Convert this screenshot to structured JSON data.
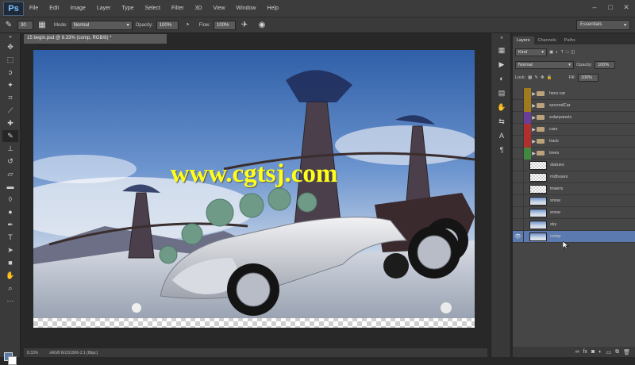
{
  "app": {
    "logo": "Ps"
  },
  "menu": [
    "File",
    "Edit",
    "Image",
    "Layer",
    "Type",
    "Select",
    "Filter",
    "3D",
    "View",
    "Window",
    "Help"
  ],
  "window_controls": [
    "–",
    "□",
    "✕"
  ],
  "options": {
    "brush_size": "30",
    "mode_label": "Mode:",
    "mode_value": "Normal",
    "opacity_label": "Opacity:",
    "opacity_value": "100%",
    "flow_label": "Flow:",
    "flow_value": "100%",
    "workspace": "Essentials"
  },
  "document": {
    "tab_title": "15 begin.psd @ 8.33% (comp, RGB/8) *",
    "watermark": "www.cgtsj.com"
  },
  "status": {
    "zoom": "8.33%",
    "info": "sRGB IEC61966-2.1 (8bpc)"
  },
  "layers_panel": {
    "tabs": [
      "Layers",
      "Channels",
      "Paths"
    ],
    "filter_kind": "Kind",
    "blend_mode": "Normal",
    "opacity_label": "Opacity:",
    "opacity_value": "100%",
    "lock_label": "Lock:",
    "fill_label": "Fill:",
    "fill_value": "100%",
    "layers": [
      {
        "name": "hero car",
        "type": "group",
        "color": "#a07a1e"
      },
      {
        "name": "secondCar",
        "type": "group",
        "color": "#a07a1e"
      },
      {
        "name": "solarpanels",
        "type": "group",
        "color": "#6a3f9a"
      },
      {
        "name": "cars",
        "type": "group",
        "color": "#b03030"
      },
      {
        "name": "track",
        "type": "group",
        "color": "#b03030"
      },
      {
        "name": "trees",
        "type": "group",
        "color": "#3f8a3f"
      },
      {
        "name": "statues",
        "type": "layer",
        "thumb": "trans"
      },
      {
        "name": "mdbuses",
        "type": "layer",
        "thumb": "trans"
      },
      {
        "name": "towers",
        "type": "layer",
        "thumb": "trans"
      },
      {
        "name": "snow",
        "type": "layer",
        "thumb": "img"
      },
      {
        "name": "snow",
        "type": "layer",
        "thumb": "img"
      },
      {
        "name": "sky",
        "type": "layer",
        "thumb": "img"
      },
      {
        "name": "comp",
        "type": "layer",
        "thumb": "img",
        "selected": true,
        "visible": true
      }
    ]
  },
  "colors": {
    "foreground": "#5a7aa8",
    "background": "#ffffff",
    "selection": "#5a7ab0"
  }
}
